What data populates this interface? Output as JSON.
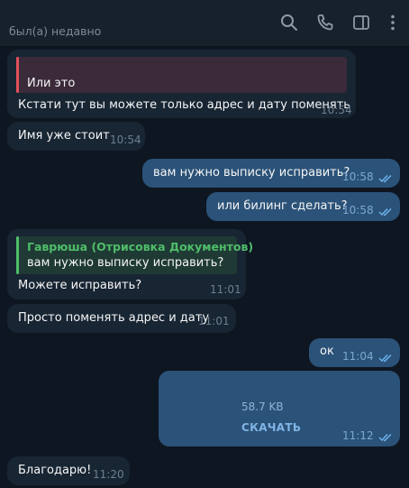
{
  "header": {
    "status": "был(а) недавно",
    "icons": [
      "search-icon",
      "phone-icon",
      "sidebar-toggle-icon",
      "more-vertical-icon"
    ]
  },
  "messages": {
    "m1": {
      "reply_text": "Или это",
      "text": "Кстати тут вы можете только адрес и дату поменять",
      "time": "10:54"
    },
    "m2": {
      "text": "Имя уже стоит",
      "time": "10:54"
    },
    "m3": {
      "text": "вам нужно выписку исправить?",
      "time": "10:58"
    },
    "m4": {
      "text": "или билинг сделать?",
      "time": "10:58"
    },
    "m5": {
      "reply_name": "Гаврюша (Отрисовка Документов)",
      "reply_text": "вам нужно выписку исправить?",
      "text": "Можете исправить?",
      "time": "11:01"
    },
    "m6": {
      "text": "Просто поменять адрес и дату",
      "time": "11:01"
    },
    "m7": {
      "text": "ок",
      "time": "11:04"
    },
    "m8": {
      "file_size": "58.7 KB",
      "download_label": "СКАЧАТЬ",
      "time": "11:12"
    },
    "m9": {
      "text": "Благодарю!",
      "time": "11:20"
    }
  },
  "colors": {
    "background": "#0e1621",
    "header": "#17212b",
    "incoming_bubble": "#182533",
    "outgoing_bubble": "#2b5278",
    "reply_accent_red": "#e0505a",
    "reply_accent_green": "#4fbd6a"
  }
}
